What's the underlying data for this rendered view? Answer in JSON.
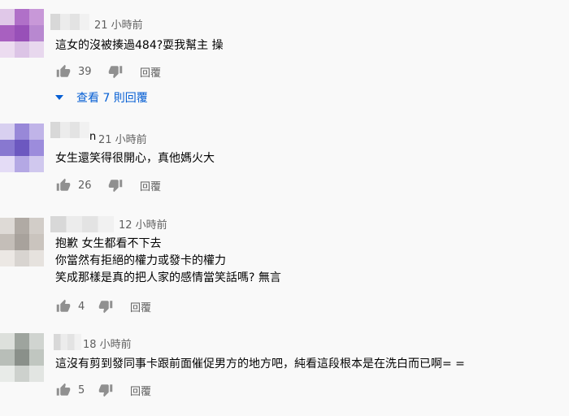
{
  "comments": [
    {
      "time": "21 小時前",
      "text_lines": [
        "這女的沒被揍過484?耍我幫主 操"
      ],
      "likes": "39",
      "reply_label": "回覆",
      "view_replies_label": "查看 7 則回覆"
    },
    {
      "name_visible": "n",
      "time": "21 小時前",
      "text_lines": [
        "女生還笑得很開心，真他媽火大"
      ],
      "likes": "26",
      "reply_label": "回覆"
    },
    {
      "time": "12 小時前",
      "text_lines": [
        "抱歉 女生都看不下去",
        "你當然有拒絕的權力或發卡的權力",
        "笑成那樣是真的把人家的感情當笑話嗎? 無言"
      ],
      "likes": "4",
      "reply_label": "回覆"
    },
    {
      "time": "18 小時前",
      "text_lines": [
        "這沒有剪到發同事卡跟前面催促男方的地方吧，純看這段根本是在洗白而已啊= ="
      ],
      "likes": "5",
      "reply_label": "回覆"
    }
  ],
  "icons": {
    "like": "thumbs-up-icon",
    "dislike": "thumbs-down-icon",
    "expand": "caret-down-icon"
  },
  "colors": {
    "background": "#f9f9f9",
    "meta_text": "#606060",
    "link_blue": "#065fd4",
    "icon": "#909090"
  }
}
